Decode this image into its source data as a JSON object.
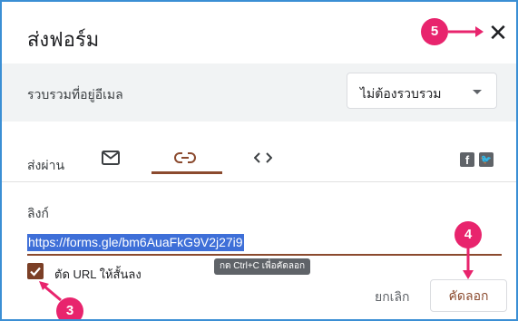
{
  "dialog": {
    "title": "ส่งฟอร์ม",
    "close_glyph": "✕"
  },
  "collect": {
    "label": "รวบรวมที่อยู่อีเมล",
    "selected": "ไม่ต้องรวบรวม"
  },
  "send_via": {
    "label": "ส่งผ่าน",
    "tabs": [
      {
        "icon": "mail-icon"
      },
      {
        "icon": "link-icon",
        "active": true
      },
      {
        "icon": "embed-code-icon"
      }
    ],
    "social": [
      {
        "icon": "facebook-icon",
        "glyph": "f"
      },
      {
        "icon": "twitter-icon",
        "glyph": "🐦"
      }
    ]
  },
  "link": {
    "heading": "ลิงก์",
    "url": "https://forms.gle/bm6AuaFkG9V2j27i9",
    "shorten_label": "ตัด URL ให้สั้นลง",
    "shorten_checked": true,
    "tooltip": "กด Ctrl+C เพื่อคัดลอก"
  },
  "actions": {
    "cancel": "ยกเลิก",
    "copy": "คัดลอก"
  },
  "annotations": {
    "badge_3": "3",
    "badge_4": "4",
    "badge_5": "5",
    "color": "#e8246d"
  },
  "colors": {
    "accent": "#8b4a2e",
    "url_highlight": "#3e6fd8",
    "frame": "#3b8fd4"
  }
}
